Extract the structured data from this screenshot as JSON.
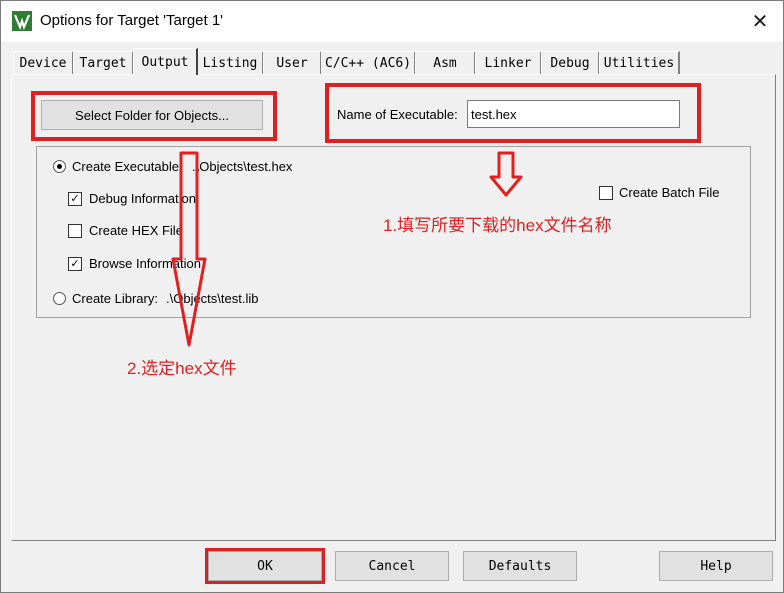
{
  "window": {
    "title": "Options for Target 'Target 1'",
    "close_glyph": "✕"
  },
  "tabs": [
    "Device",
    "Target",
    "Output",
    "Listing",
    "User",
    "C/C++ (AC6)",
    "Asm",
    "Linker",
    "Debug",
    "Utilities"
  ],
  "active_tab": "Output",
  "output": {
    "select_folder_button": "Select Folder for Objects...",
    "name_label": "Name of Executable:",
    "name_value": "test.hex",
    "create_executable_label": "Create Executable:",
    "create_executable_path": ".\\Objects\\test.hex",
    "debug_info_label": "Debug Information",
    "debug_info_checked": true,
    "create_hex_label": "Create HEX File",
    "create_hex_checked": false,
    "browse_info_label": "Browse Information",
    "browse_info_checked": true,
    "create_library_label": "Create Library:",
    "create_library_path": ".\\Objects\\test.lib",
    "create_batch_label": "Create Batch File",
    "create_batch_checked": false,
    "selected_mode": "Create Executable"
  },
  "annotations": {
    "step1": "1.填写所要下载的hex文件名称",
    "step2": "2.选定hex文件",
    "color": "#e02020"
  },
  "footer": {
    "ok": "OK",
    "cancel": "Cancel",
    "defaults": "Defaults",
    "help": "Help"
  }
}
